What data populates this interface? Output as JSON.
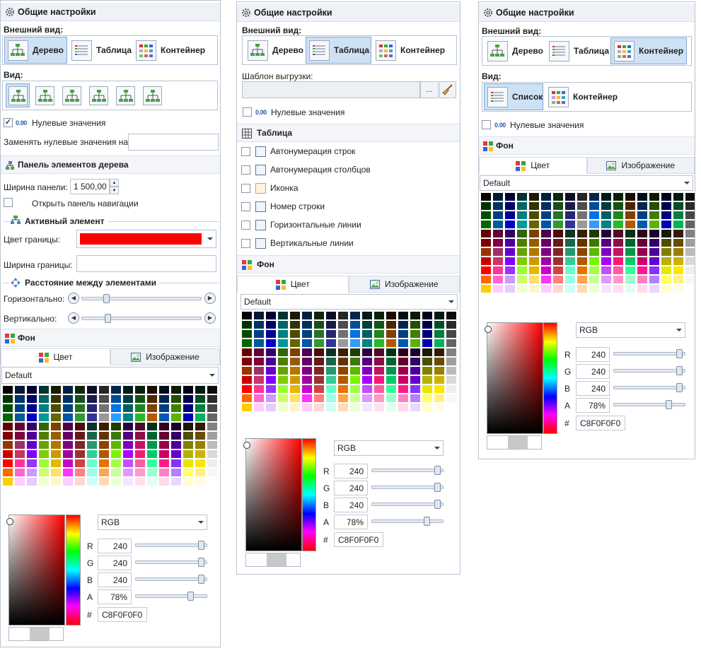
{
  "colors": {
    "accent": "#cfe1f5",
    "border_color_swatch": "#ff0000"
  },
  "panel1": {
    "header": "Общие настройки",
    "appearance_label": "Внешний вид:",
    "appearance": [
      "Дерево",
      "Таблица",
      "Контейнер"
    ],
    "view_label": "Вид:",
    "zero_icon": "0.00",
    "zero_values": "Нулевые значения",
    "replace_zero_label": "Заменять нулевые значения на :",
    "replace_zero_value": "",
    "tree_panel_header": "Панель элементов дерева",
    "panel_width_label": "Ширина панели:",
    "panel_width_value": "1 500,00",
    "open_nav": "Открыть панель навигации",
    "active_elem": "Активный элемент",
    "border_color_label": "Цвет границы:",
    "border_width_label": "Ширина границы:",
    "border_width_value": "",
    "distance": "Расстояние между элементами",
    "horizontal": "Горизонтально:",
    "vertical": "Вертикально:",
    "background": "Фон",
    "tab_color": "Цвет",
    "tab_image": "Изображение",
    "palette": "Default",
    "model": "RGB",
    "r_label": "R",
    "r": "240",
    "g_label": "G",
    "g": "240",
    "b_label": "B",
    "b": "240",
    "a_label": "A",
    "a": "78%",
    "hash": "#",
    "hex": "C8F0F0F0"
  },
  "panel2": {
    "header": "Общие настройки",
    "appearance_label": "Внешний вид:",
    "appearance": [
      "Дерево",
      "Таблица",
      "Контейнер"
    ],
    "template_label": "Шаблон выгрузки:",
    "template_value": "",
    "browse": "...",
    "zero_icon": "0.00",
    "zero_values": "Нулевые значения",
    "table_header": "Таблица",
    "table_options": [
      "Автонумерация строк",
      "Автонумерация столбцов",
      "Иконка",
      "Номер строки",
      "Горизонтальные линии",
      "Вертикальные линии"
    ],
    "background": "Фон",
    "tab_color": "Цвет",
    "tab_image": "Изображение",
    "palette": "Default",
    "model": "RGB",
    "r_label": "R",
    "r": "240",
    "g_label": "G",
    "g": "240",
    "b_label": "B",
    "b": "240",
    "a_label": "A",
    "a": "78%",
    "hash": "#",
    "hex": "C8F0F0F0"
  },
  "panel3": {
    "header": "Общие настройки",
    "appearance_label": "Внешний вид:",
    "appearance": [
      "Дерево",
      "Таблица",
      "Контейнер"
    ],
    "view_label": "Вид:",
    "view": [
      "Список",
      "Контейнер"
    ],
    "zero_icon": "0.00",
    "zero_values": "Нулевые значения",
    "background": "Фон",
    "tab_color": "Цвет",
    "tab_image": "Изображение",
    "palette": "Default",
    "model": "RGB",
    "r_label": "R",
    "r": "240",
    "g_label": "G",
    "g": "240",
    "b_label": "B",
    "b": "240",
    "a_label": "A",
    "a": "78%",
    "hash": "#",
    "hex": "C8F0F0F0"
  }
}
